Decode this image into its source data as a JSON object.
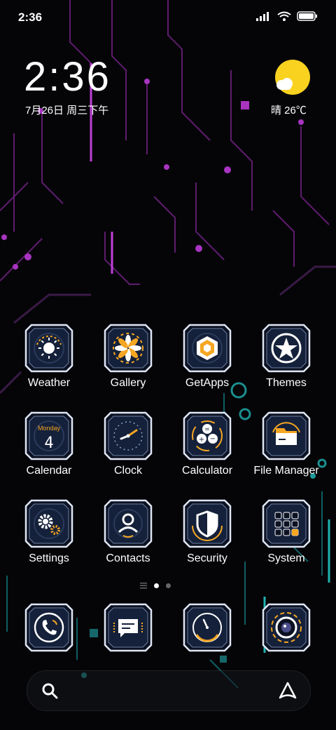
{
  "status_bar": {
    "time": "2:36"
  },
  "lockscreen_widget": {
    "time": "2:36",
    "date": "7月26日 周三下午",
    "weather": "晴 26℃"
  },
  "apps": [
    {
      "label": "Weather",
      "icon": "weather-sun-icon"
    },
    {
      "label": "Gallery",
      "icon": "gallery-flower-icon"
    },
    {
      "label": "GetApps",
      "icon": "getapps-cube-icon"
    },
    {
      "label": "Themes",
      "icon": "themes-star-icon"
    },
    {
      "label": "Calendar",
      "icon": "calendar-icon",
      "day": "Monday",
      "number": "4"
    },
    {
      "label": "Clock",
      "icon": "clock-icon"
    },
    {
      "label": "Calculator",
      "icon": "calculator-icon"
    },
    {
      "label": "File Manager",
      "icon": "folder-icon"
    },
    {
      "label": "Settings",
      "icon": "gear-icon"
    },
    {
      "label": "Contacts",
      "icon": "contact-person-icon"
    },
    {
      "label": "Security",
      "icon": "shield-icon"
    },
    {
      "label": "System",
      "icon": "system-grid-icon"
    }
  ],
  "dock": [
    {
      "icon": "phone-icon"
    },
    {
      "icon": "message-icon"
    },
    {
      "icon": "browser-compass-icon"
    },
    {
      "icon": "camera-icon"
    }
  ],
  "colors": {
    "accent_purple": "#b03cc8",
    "accent_teal": "#21b3b0",
    "accent_orange": "#f5a623",
    "tile_bg": "#16233c"
  }
}
